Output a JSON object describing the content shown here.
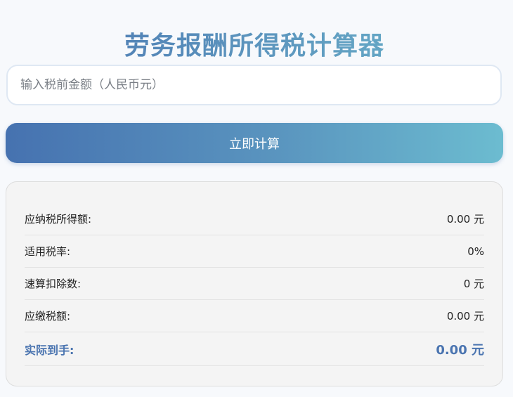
{
  "app": {
    "title": "劳务报酬所得税计算器"
  },
  "input": {
    "placeholder": "输入税前金额（人民币元）",
    "value": ""
  },
  "button": {
    "label": "立即计算"
  },
  "results": [
    {
      "label": "应纳税所得额:",
      "value": "0.00 元"
    },
    {
      "label": "适用税率:",
      "value": "0%"
    },
    {
      "label": "速算扣除数:",
      "value": "0 元"
    },
    {
      "label": "应缴税额:",
      "value": "0.00 元"
    },
    {
      "label": "实际到手:",
      "value": "0.00 元"
    }
  ],
  "colors": {
    "accent": "#4a74b0",
    "accent_light": "#6cbcd0",
    "background": "#f7f9fc",
    "card": "#f4f4f4"
  }
}
